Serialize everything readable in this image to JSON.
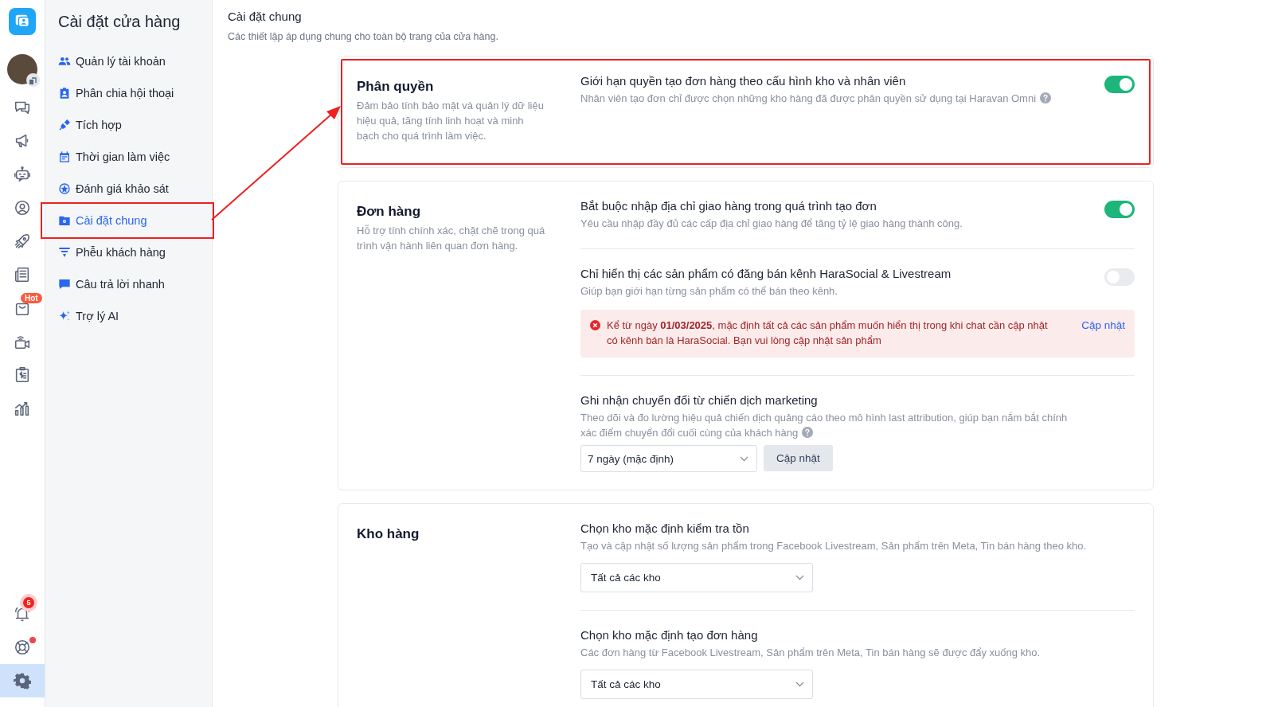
{
  "rail": {
    "top_items": [
      {
        "kind": "chat",
        "selected": false
      },
      {
        "kind": "megaphone",
        "selected": false
      },
      {
        "kind": "robot",
        "selected": false
      },
      {
        "kind": "user",
        "selected": false
      },
      {
        "kind": "rocket",
        "selected": false
      },
      {
        "kind": "news",
        "selected": false
      },
      {
        "kind": "bag",
        "selected": false,
        "badge": "Hot"
      },
      {
        "kind": "video",
        "selected": false
      },
      {
        "kind": "invoice",
        "selected": false
      },
      {
        "kind": "chart",
        "selected": false
      }
    ],
    "bottom_items": [
      {
        "kind": "bell",
        "selected": false,
        "badge": "5"
      },
      {
        "kind": "lifebuoy",
        "selected": false,
        "dot": true
      },
      {
        "kind": "gear",
        "selected": true
      }
    ]
  },
  "nav": {
    "title": "Cài đặt cửa hàng",
    "items": [
      {
        "label": "Quản lý tài khoản",
        "selected": false,
        "highlighted": false
      },
      {
        "label": "Phân chia hội thoại",
        "selected": false,
        "highlighted": false
      },
      {
        "label": "Tích hợp",
        "selected": false,
        "highlighted": false
      },
      {
        "label": "Thời gian làm việc",
        "selected": false,
        "highlighted": false
      },
      {
        "label": "Đánh giá khảo sát",
        "selected": false,
        "highlighted": false
      },
      {
        "label": "Cài đặt chung",
        "selected": true,
        "highlighted": true
      },
      {
        "label": "Phễu khách hàng",
        "selected": false,
        "highlighted": false
      },
      {
        "label": "Câu trả lời nhanh",
        "selected": false,
        "highlighted": false
      },
      {
        "label": "Trợ lý AI",
        "selected": false,
        "highlighted": false
      }
    ]
  },
  "page": {
    "title": "Cài đặt chung",
    "subtitle": "Các thiết lập áp dụng chung cho toàn bộ trang của cửa hàng."
  },
  "sections": [
    {
      "title": "Phân quyền",
      "description": "Đảm bảo tính bảo mật và quản lý dữ liệu hiệu quả, tăng tính linh hoạt và minh bạch cho quá trình làm việc.",
      "highlighted": true,
      "settings": [
        {
          "kind": "toggle",
          "title": "Giới hạn quyền tạo đơn hàng theo cấu hình kho và nhân viên",
          "description": "Nhân viên tạo đơn chỉ được chọn những kho hàng đã được phân quyền sử dụng tại Haravan Omni",
          "help": true,
          "on": true
        }
      ]
    },
    {
      "title": "Đơn hàng",
      "description": "Hỗ trợ tính chính xác, chặt chẽ trong quá trình vận hành liên quan đơn hàng.",
      "highlighted": false,
      "settings": [
        {
          "kind": "toggle",
          "title": "Bắt buộc nhập địa chỉ giao hàng trong quá trình tạo đơn",
          "description": "Yêu cầu nhập đầy đủ các cấp địa chỉ giao hàng để tăng tỷ lệ giao hàng thành công.",
          "help": false,
          "on": true
        },
        {
          "kind": "toggle",
          "title": "Chỉ hiển thị các sản phẩm có đăng bán kênh HaraSocial & Livestream",
          "description": "Giúp bạn giới hạn từng sản phẩm có thể bán theo kênh.",
          "help": false,
          "on": false,
          "alert": {
            "text": "Kể từ ngày **01/03/2025**, mặc định tất cả các sản phẩm muốn hiển thị trong khi chat cần cập nhật có kênh bán là HaraSocial. Bạn vui lòng cập nhật sản phẩm",
            "link": "Cập nhật"
          }
        },
        {
          "kind": "select",
          "title": "Ghi nhận chuyển đổi từ chiến dịch marketing",
          "description": "Theo dõi và đo lường hiệu quả chiến dịch quảng cáo theo mô hình last attribution, giúp bạn nắm bắt chính xác điểm chuyển đổi cuối cùng của khách hàng",
          "help": true,
          "value": "7 ngày (mặc định)",
          "button": "Cập nhật"
        }
      ]
    },
    {
      "title": "Kho hàng",
      "highlighted": false,
      "settings": [
        {
          "kind": "select",
          "title": "Chọn kho mặc định kiểm tra tồn",
          "description": "Tạo và cập nhật số lượng sản phẩm trong Facebook Livestream, Sản phẩm trên Meta, Tin bán hàng theo kho.",
          "help": false,
          "value": "Tất cả các kho"
        },
        {
          "kind": "select",
          "title": "Chọn kho mặc định tạo đơn hàng",
          "description": "Các đơn hàng từ Facebook Livestream, Sản phẩm trên Meta, Tin bán hàng sẽ được đẩy xuống kho.",
          "help": false,
          "value": "Tất cả các kho"
        }
      ]
    }
  ]
}
